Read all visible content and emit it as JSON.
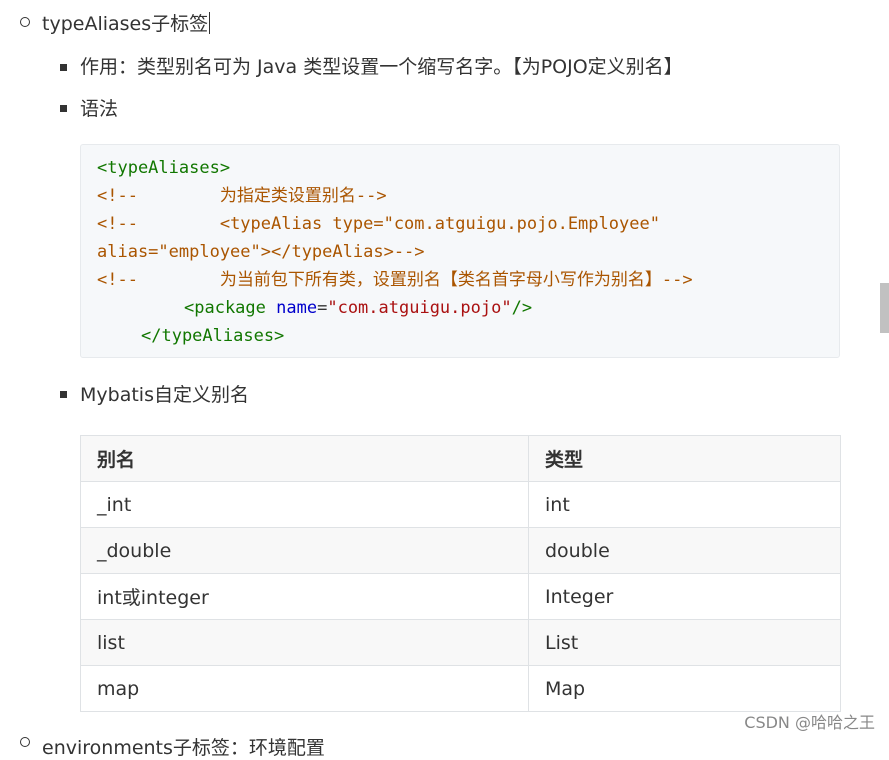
{
  "items": {
    "type_aliases_heading": "typeAliases子标签",
    "purpose": "作用：类型别名可为 Java 类型设置一个缩写名字。【为POJO定义别名】",
    "syntax": "语法",
    "mybatis_aliases": "Mybatis自定义别名"
  },
  "code": {
    "line1": "<typeAliases>",
    "line2_open": "<!--",
    "line2_text": "        为指定类设置别名",
    "line2_close": "-->",
    "line3_open": "<!--",
    "line3_text": "        <typeAlias type=\"com.atguigu.pojo.Employee\"",
    "line4_text": "alias=\"employee\"></typeAlias>",
    "line4_close": "-->",
    "line5_open": "<!--",
    "line5_text": "        为当前包下所有类，设置别名【类名首字母小写作为别名】",
    "line5_close": "-->",
    "line6_tag_open": "<package",
    "line6_attr": "name",
    "line6_eq": "=",
    "line6_val": "\"com.atguigu.pojo\"",
    "line6_tag_close": "/>",
    "line7": "</typeAliases>"
  },
  "table": {
    "headers": [
      "别名",
      "类型"
    ],
    "rows": [
      [
        "_int",
        "int"
      ],
      [
        "_double",
        "double"
      ],
      [
        "int或integer",
        "Integer"
      ],
      [
        "list",
        "List"
      ],
      [
        "map",
        "Map"
      ]
    ]
  },
  "next_item_partial": "environments子标签：环境配置",
  "watermark": "CSDN @哈哈之王"
}
